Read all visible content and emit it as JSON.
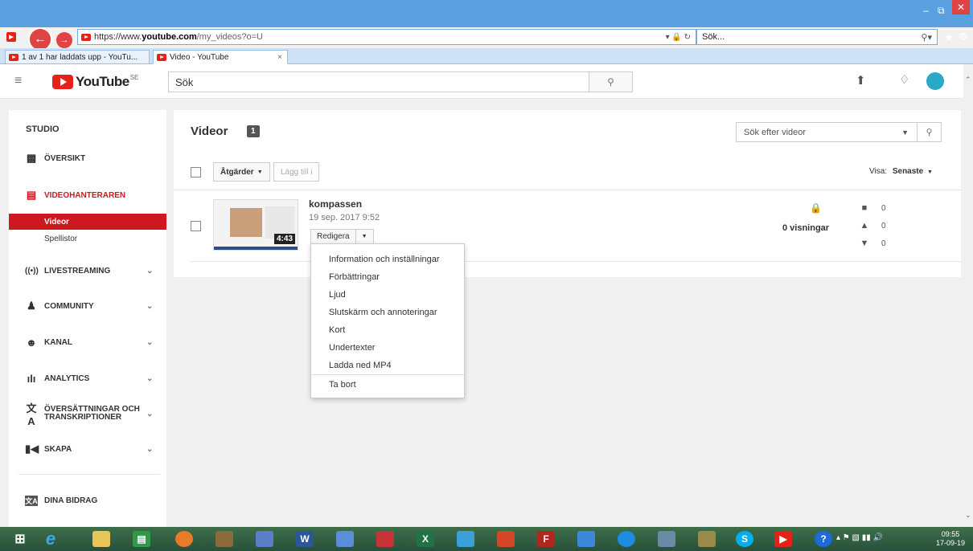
{
  "browser": {
    "url_prefix": "https://www.",
    "url_domain": "youtube.com",
    "url_path": "/my_videos?o=U",
    "search_placeholder": "Sök...",
    "tabs": [
      {
        "label": "1 av 1 har laddats upp - YouTu..."
      },
      {
        "label": "Video - YouTube"
      }
    ]
  },
  "header": {
    "logo_text": "YouTube",
    "logo_region": "SE",
    "search_placeholder": "Sök"
  },
  "sidebar": {
    "title": "STUDIO",
    "items": [
      {
        "label": "ÖVERSIKT"
      },
      {
        "label": "VIDEOHANTERAREN"
      },
      {
        "label": "LIVESTREAMING"
      },
      {
        "label": "COMMUNITY"
      },
      {
        "label": "KANAL"
      },
      {
        "label": "ANALYTICS"
      },
      {
        "label": "ÖVERSÄTTNINGAR OCH TRANSKRIPTIONER"
      },
      {
        "label": "SKAPA"
      },
      {
        "label": "DINA BIDRAG"
      }
    ],
    "sub_items": [
      {
        "label": "Videor"
      },
      {
        "label": "Spellistor"
      }
    ]
  },
  "main": {
    "title": "Videor",
    "count": "1",
    "search_placeholder": "Sök efter videor",
    "actions_label": "Åtgärder",
    "add_to_label": "Lägg till i",
    "view_label": "Visa:",
    "view_value": "Senaste"
  },
  "video": {
    "title": "kompassen",
    "date": "19 sep. 2017 9:52",
    "duration": "4:43",
    "edit_label": "Redigera",
    "views": "0 visningar",
    "comments": "0",
    "likes": "0",
    "dislikes": "0"
  },
  "menu": {
    "items": [
      {
        "label": "Information och inställningar"
      },
      {
        "label": "Förbättringar"
      },
      {
        "label": "Ljud"
      },
      {
        "label": "Slutskärm och annoteringar"
      },
      {
        "label": "Kort"
      },
      {
        "label": "Undertexter"
      },
      {
        "label": "Ladda ned MP4"
      },
      {
        "label": "Ta bort"
      }
    ]
  },
  "taskbar": {
    "time": "09:55",
    "date": "17-09-19"
  },
  "colors": {
    "accent": "#cc181e",
    "brand": "#e62117",
    "chrome": "#5aa0e0",
    "taskbar": "#2f5b40"
  }
}
